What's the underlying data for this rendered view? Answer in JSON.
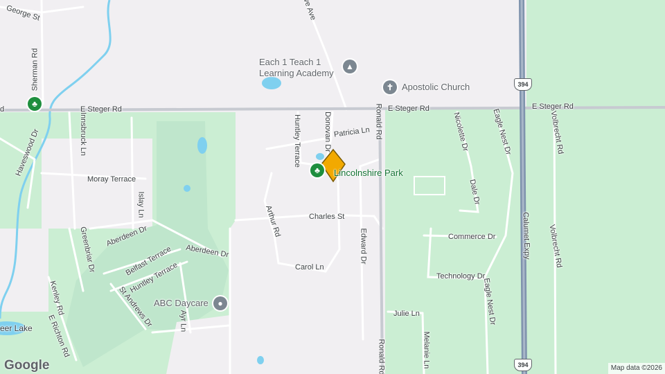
{
  "colors": {
    "background": "#f1eff2",
    "park": "#bfe6cc",
    "wooded": "#cbeed3",
    "road": "#ffffff",
    "arterial": "#c7cad1",
    "highway": "#7f93ad",
    "water": "#7fd0ef",
    "marker": "#f2a900"
  },
  "roads": {
    "e_steger_rd_1": "E Steger Rd",
    "e_steger_rd_2": "E Steger Rd",
    "e_steger_rd_3": "E Steger Rd",
    "george_st": "George St",
    "sherman_rd": "Sherman Rd",
    "haveswood_dr": "Haveswood Dr",
    "innsbruck_ln": "Innsbruck Ln",
    "moray_terrace": "Moray Terrace",
    "islay_ln": "Islay Ln",
    "aberdeen_dr_1": "Aberdeen Dr",
    "aberdeen_dr_2": "Aberdeen Dr",
    "greenbriar_dr": "Greenbriar Dr",
    "belfast_terrace": "Belfast Terrace",
    "huntley_terrace_1": "Huntley Terrace",
    "huntley_terrace_2": "Huntley Terrace",
    "st_andrews_dr": "St Andrews Dr",
    "ayr_ln": "Ayr Ln",
    "kenley_rd": "Kenley Rd",
    "e_richton_rd": "E Richton Rd",
    "donovan_dr": "Donovan Dr",
    "patricia_ln": "Patricia Ln",
    "ronald_rd_1": "Ronald Rd",
    "ronald_rd_2": "Ronald Rd",
    "arthur_rd": "Arthur Rd",
    "charles_st": "Charles St",
    "edward_dr": "Edward Dr",
    "carol_ln": "Carol Ln",
    "julie_ln": "Julie Ln",
    "melanie_ln": "Melanie Ln",
    "nicolette_dr": "Nicolette Dr",
    "eagle_nest_dr_1": "Eagle Nest Dr",
    "eagle_nest_dr_2": "Eagle Nest Dr",
    "dale_dr": "Dale Dr",
    "commerce_dr": "Commerce Dr",
    "technology_dr": "Technology Dr",
    "calumet_expy": "Calumet Expy",
    "volbrecht_rd_1": "Volbrecht Rd",
    "volbrecht_rd_2": "Volbrecht Rd",
    "avenue_top": "ve Ave",
    "lake": "eer Lake",
    "e_steger_rd_left": "d"
  },
  "places": {
    "school_line1": "Each 1 Teach 1",
    "school_line2": "Learning Academy",
    "church": "Apostolic Church",
    "park": "Lincolnshire Park",
    "daycare": "ABC Daycare"
  },
  "shields": {
    "top": "394",
    "bottom": "394"
  },
  "google_logo": "Google",
  "attribution": "Map data ©2026"
}
